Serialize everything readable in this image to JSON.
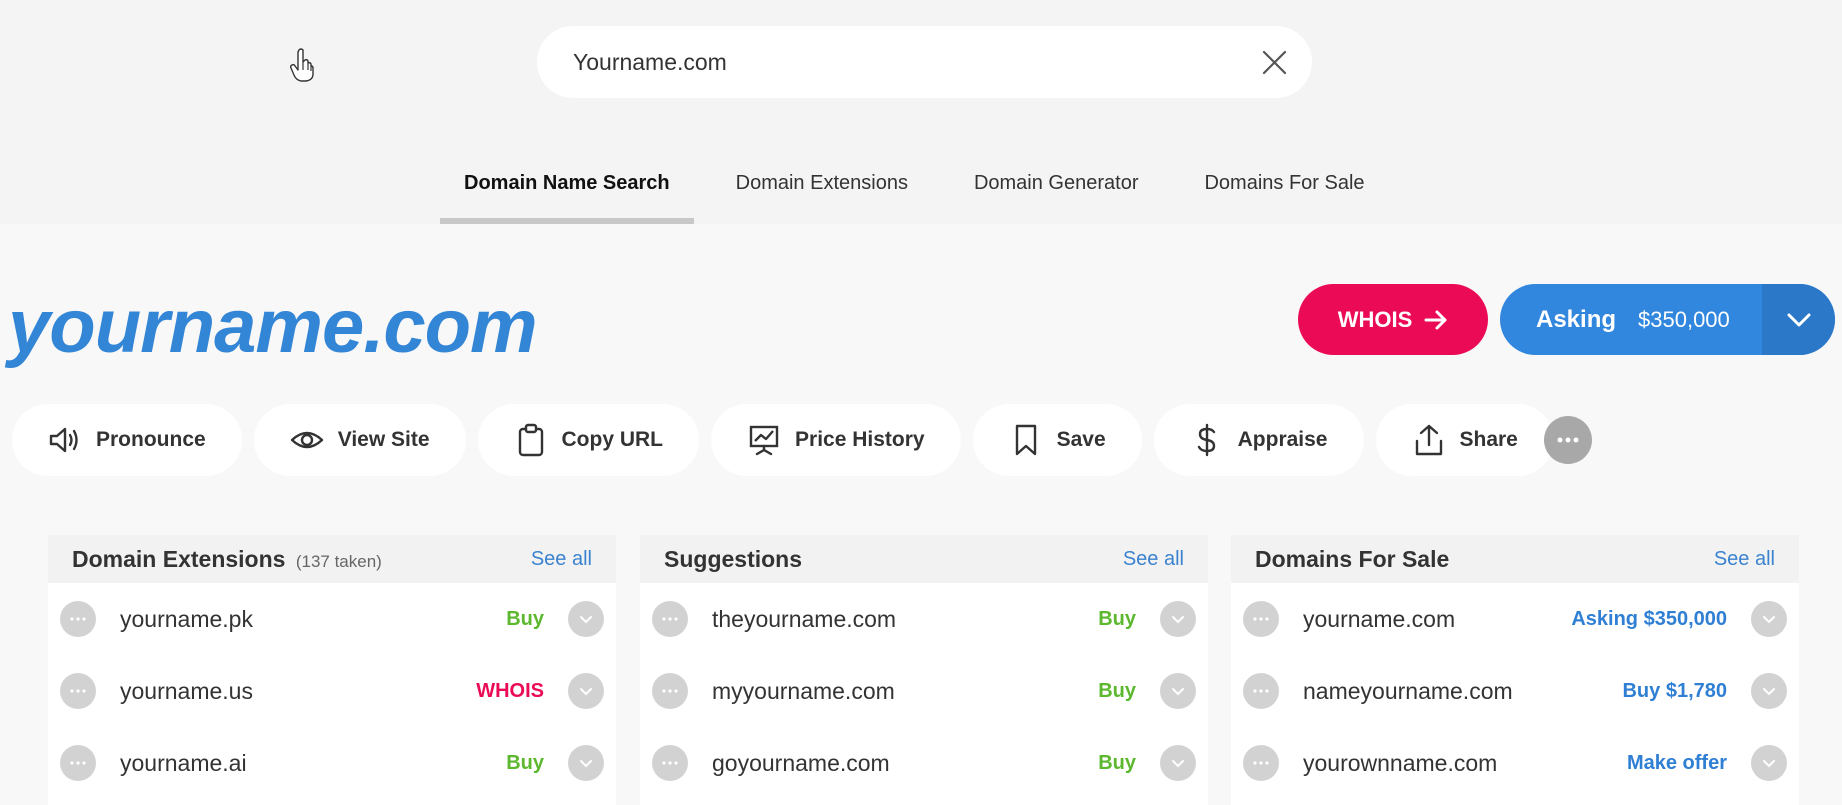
{
  "search": {
    "value": "Yourname.com"
  },
  "tabs": [
    {
      "label": "Domain Name Search"
    },
    {
      "label": "Domain Extensions"
    },
    {
      "label": "Domain Generator"
    },
    {
      "label": "Domains For Sale"
    }
  ],
  "domain": {
    "title": "yourname.com",
    "whois_label": "WHOIS",
    "asking_label": "Asking",
    "asking_price": "$350,000"
  },
  "actions": {
    "pronounce": "Pronounce",
    "view_site": "View Site",
    "copy_url": "Copy URL",
    "price_history": "Price History",
    "save": "Save",
    "appraise": "Appraise",
    "share": "Share"
  },
  "panels": [
    {
      "title": "Domain Extensions",
      "note": "(137 taken)",
      "see_all": "See all",
      "rows": [
        {
          "name": "yourname.pk",
          "status": "Buy"
        },
        {
          "name": "yourname.us",
          "status": "WHOIS"
        },
        {
          "name": "yourname.ai",
          "status": "Buy"
        }
      ]
    },
    {
      "title": "Suggestions",
      "see_all": "See all",
      "rows": [
        {
          "name": "theyourname.com",
          "status": "Buy"
        },
        {
          "name": "myyourname.com",
          "status": "Buy"
        },
        {
          "name": "goyourname.com",
          "status": "Buy"
        }
      ]
    },
    {
      "title": "Domains For Sale",
      "see_all": "See all",
      "rows": [
        {
          "name": "yourname.com",
          "status": "Asking $350,000"
        },
        {
          "name": "nameyourname.com",
          "status": "Buy $1,780"
        },
        {
          "name": "yourownname.com",
          "status": "Make offer"
        }
      ]
    }
  ],
  "colors": {
    "brand_blue": "#3385d6",
    "whois_red": "#eb0a55",
    "buy_green": "#5cb82e",
    "sale_blue": "#2f7fd4"
  }
}
